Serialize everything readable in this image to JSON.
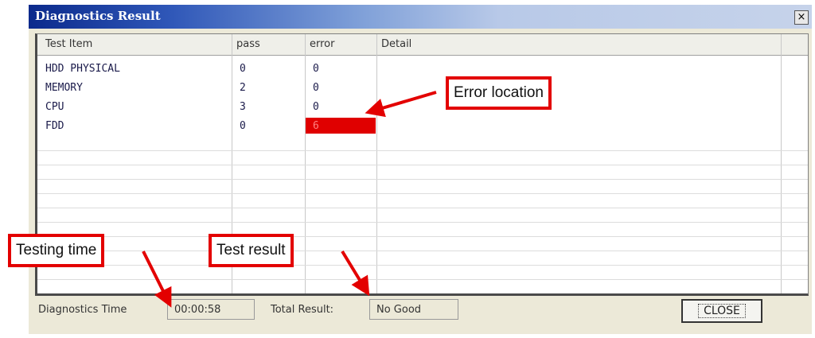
{
  "window": {
    "title": "Diagnostics Result",
    "close_glyph": "×"
  },
  "table": {
    "columns": [
      "Test Item",
      "pass",
      "error",
      "Detail"
    ],
    "rows": [
      {
        "item": "HDD PHYSICAL",
        "pass": "0",
        "error": "0",
        "detail": ""
      },
      {
        "item": "MEMORY",
        "pass": "2",
        "error": "0",
        "detail": ""
      },
      {
        "item": "CPU",
        "pass": "3",
        "error": "0",
        "detail": ""
      },
      {
        "item": "FDD",
        "pass": "0",
        "error": "6",
        "detail": ""
      }
    ],
    "error_highlight_color": "#e00000"
  },
  "footer": {
    "time_label": "Diagnostics Time",
    "time_value": "00:00:58",
    "result_label": "Total Result:",
    "result_value": "No Good",
    "close_label": "CLOSE"
  },
  "annotations": {
    "error_location": "Error location",
    "testing_time": "Testing time",
    "test_result": "Test result",
    "color": "#e30000"
  }
}
